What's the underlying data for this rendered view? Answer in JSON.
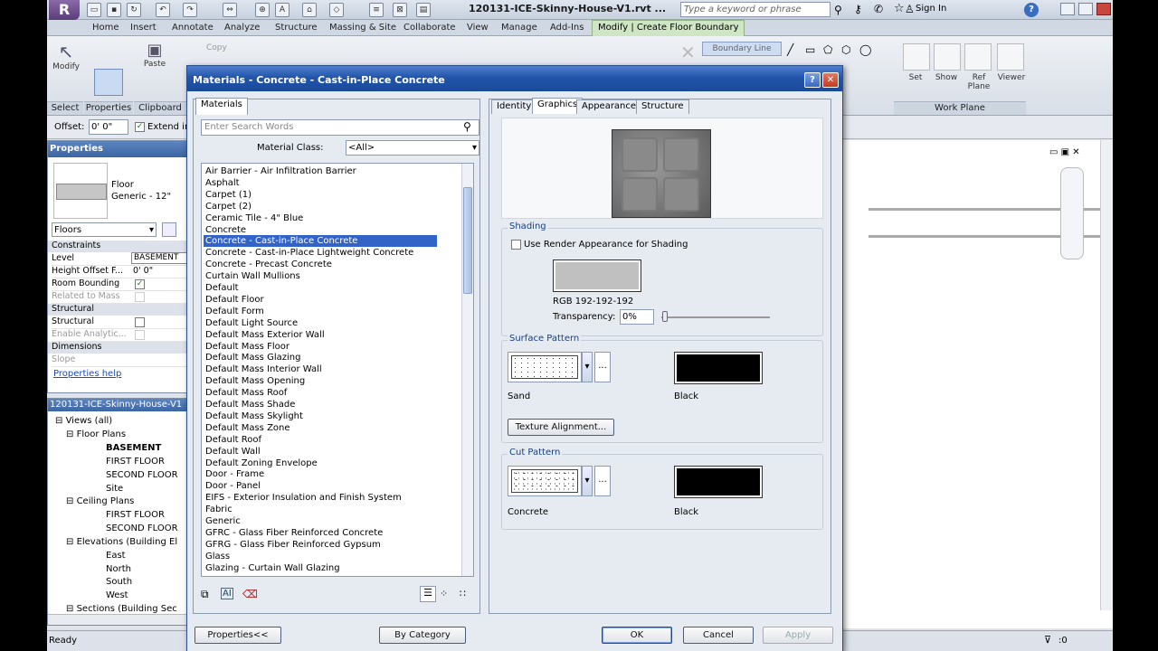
{
  "app": {
    "file_title": "120131-ICE-Skinny-House-V1.rvt ...",
    "search_placeholder": "Type a keyword or phrase",
    "sign_in": "Sign In",
    "help": "?"
  },
  "ribbon": {
    "tabs": [
      "Home",
      "Insert",
      "Annotate",
      "Analyze",
      "Structure",
      "Massing & Site",
      "Collaborate",
      "View",
      "Manage",
      "Add-Ins",
      "Modify | Create Floor Boundary"
    ],
    "modify": "Modify",
    "paste": "Paste",
    "copy": "Copy",
    "boundary_line": "Boundary Line",
    "set": "Set",
    "show": "Show",
    "ref_plane": "Ref Plane",
    "viewer": "Viewer",
    "panels": {
      "select": "Select",
      "properties": "Properties",
      "clipboard": "Clipboard",
      "work_plane": "Work Plane"
    }
  },
  "options_bar": {
    "offset_label": "Offset:",
    "offset_value": "0' 0\"",
    "extend_label": "Extend in"
  },
  "properties": {
    "title": "Properties",
    "type_name": "Floor",
    "type_sub": "Generic - 12\"",
    "filter": "Floors",
    "groups": {
      "constraints": "Constraints",
      "structural": "Structural",
      "dimensions": "Dimensions"
    },
    "rows": {
      "level": "Level",
      "level_value": "BASEMENT",
      "height_offset": "Height Offset F...",
      "height_offset_value": "0' 0\"",
      "room_bounding": "Room Bounding",
      "related_to_mass": "Related to Mass",
      "structural": "Structural",
      "enable_analytic": "Enable Analytic...",
      "slope": "Slope"
    },
    "help_link": "Properties help"
  },
  "browser": {
    "title": "120131-ICE-Skinny-House-V1",
    "items": [
      "Views (all)",
      "Floor Plans",
      "BASEMENT",
      "FIRST FLOOR",
      "SECOND FLOOR",
      "Site",
      "Ceiling Plans",
      "FIRST FLOOR",
      "SECOND FLOOR",
      "Elevations (Building El",
      "East",
      "North",
      "South",
      "West",
      "Sections (Building Sec"
    ]
  },
  "status": {
    "text": "Ready",
    "filter_count": ":0"
  },
  "dialog": {
    "title": "Materials - Concrete - Cast-in-Place Concrete",
    "left_tab": "Materials",
    "search_placeholder": "Enter Search Words",
    "material_class_label": "Material Class:",
    "material_class_value": "<All>",
    "materials": [
      "Air Barrier - Air Infiltration Barrier",
      "Asphalt",
      "Carpet (1)",
      "Carpet (2)",
      "Ceramic Tile - 4\" Blue",
      "Concrete",
      "Concrete - Cast-in-Place Concrete",
      "Concrete - Cast-in-Place Lightweight Concrete",
      "Concrete - Precast Concrete",
      "Curtain Wall Mullions",
      "Default",
      "Default Floor",
      "Default Form",
      "Default Light Source",
      "Default Mass Exterior Wall",
      "Default Mass Floor",
      "Default Mass Glazing",
      "Default Mass Interior Wall",
      "Default Mass Opening",
      "Default Mass Roof",
      "Default Mass Shade",
      "Default Mass Skylight",
      "Default Mass Zone",
      "Default Roof",
      "Default Wall",
      "Default Zoning Envelope",
      "Door - Frame",
      "Door - Panel",
      "EIFS - Exterior Insulation and Finish System",
      "Fabric",
      "Generic",
      "GFRC - Glass Fiber Reinforced Concrete",
      "GFRG - Glass Fiber Reinforced Gypsum",
      "Glass",
      "Glazing - Curtain Wall Glazing"
    ],
    "selected_index": 6,
    "right_tabs": [
      "Identity",
      "Graphics",
      "Appearance",
      "Structure"
    ],
    "active_right_tab": "Graphics",
    "shading": {
      "title": "Shading",
      "use_render": "Use Render Appearance for Shading",
      "color_hex": "#c0c0c0",
      "rgb_label": "RGB 192-192-192",
      "transparency_label": "Transparency:",
      "transparency_value": "0%"
    },
    "surface_pattern": {
      "title": "Surface Pattern",
      "pattern_name": "Sand",
      "color_name": "Black",
      "texture_btn": "Texture Alignment..."
    },
    "cut_pattern": {
      "title": "Cut Pattern",
      "pattern_name": "Concrete",
      "color_name": "Black"
    },
    "ellipsis": "...",
    "buttons": {
      "properties": "Properties<<",
      "by_category": "By Category",
      "ok": "OK",
      "cancel": "Cancel",
      "apply": "Apply"
    }
  }
}
